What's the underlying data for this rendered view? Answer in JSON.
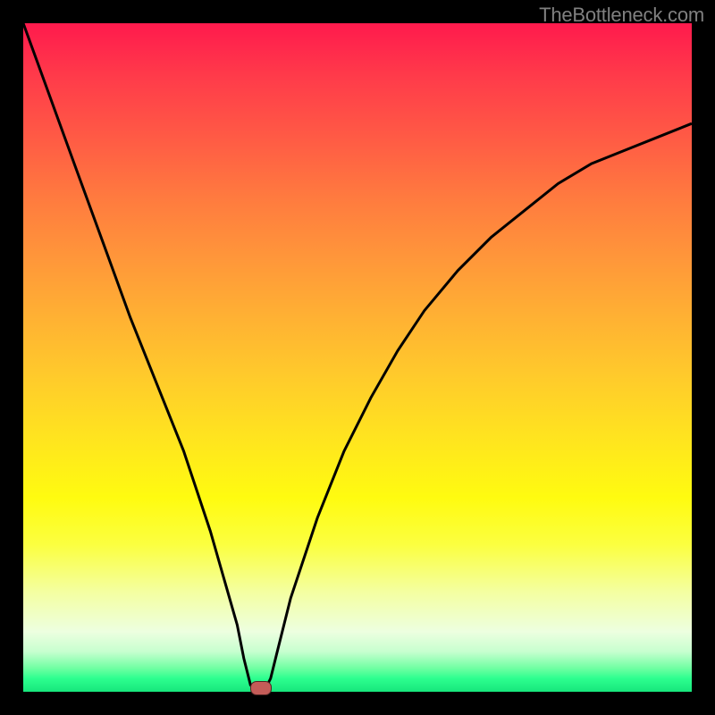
{
  "watermark": "TheBottleneck.com",
  "chart_data": {
    "type": "line",
    "title": "",
    "xlabel": "",
    "ylabel": "",
    "xlim": [
      0,
      100
    ],
    "ylim": [
      0,
      100
    ],
    "series": [
      {
        "name": "curve",
        "x": [
          0,
          4,
          8,
          12,
          16,
          20,
          24,
          28,
          30,
          32,
          33,
          34,
          35,
          36,
          37,
          38,
          40,
          44,
          48,
          52,
          56,
          60,
          65,
          70,
          75,
          80,
          85,
          90,
          95,
          100
        ],
        "y": [
          100,
          89,
          78,
          67,
          56,
          46,
          36,
          24,
          17,
          10,
          5,
          1,
          0,
          0,
          2,
          6,
          14,
          26,
          36,
          44,
          51,
          57,
          63,
          68,
          72,
          76,
          79,
          81,
          83,
          85
        ]
      }
    ],
    "marker": {
      "x": 35.5,
      "y": 0.5
    },
    "gradient_note": "background encodes bottleneck severity: green=low (bottom) through yellow and orange to red=high (top)"
  },
  "colors": {
    "frame": "#000000",
    "curve": "#000000",
    "marker": "#c45c58",
    "watermark": "#808080"
  }
}
